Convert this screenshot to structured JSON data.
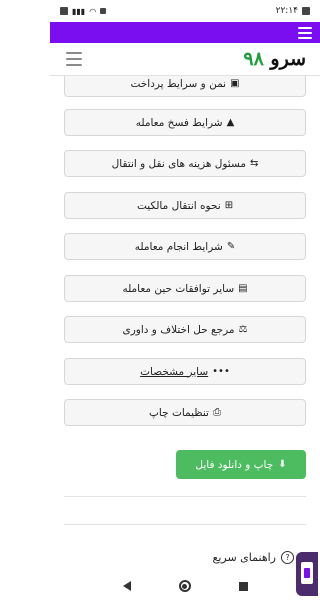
{
  "status": {
    "time": "۲۲:۱۴",
    "battery": ""
  },
  "header": {
    "brand_text": "سرو",
    "brand_number": "۹۸"
  },
  "buttons": [
    {
      "label": "نمن و سرایط پرداخت",
      "icon": "money-icon",
      "glyph": "▣"
    },
    {
      "label": "شرایط فسخ معامله",
      "icon": "warning-icon",
      "glyph": "▲"
    },
    {
      "label": "مسئول هزینه های نقل و انتقال",
      "icon": "handshake-icon",
      "glyph": "⇆"
    },
    {
      "label": "نحوه انتقال مالکیت",
      "icon": "transfer-icon",
      "glyph": "⊞"
    },
    {
      "label": "شرایط انجام معامله",
      "icon": "edit-icon",
      "glyph": "✎"
    },
    {
      "label": "سایر توافقات حین معامله",
      "icon": "document-icon",
      "glyph": "▤"
    },
    {
      "label": "مرجع حل اختلاف و داوری",
      "icon": "scale-icon",
      "glyph": "⚖"
    },
    {
      "label": "سایر مشخصات",
      "icon": "more-icon",
      "glyph": "•••"
    },
    {
      "label": "تنظیمات چاپ",
      "icon": "print-icon",
      "glyph": "⎙"
    }
  ],
  "action": {
    "label": "چاپ و دانلود فایل",
    "glyph": "⬇"
  },
  "quick_guide": {
    "label": "راهنمای سریع",
    "glyph": "?"
  },
  "colors": {
    "accent": "#7b0ef0",
    "green": "#4dbb5f",
    "brand_number": "#1f9e3c"
  }
}
